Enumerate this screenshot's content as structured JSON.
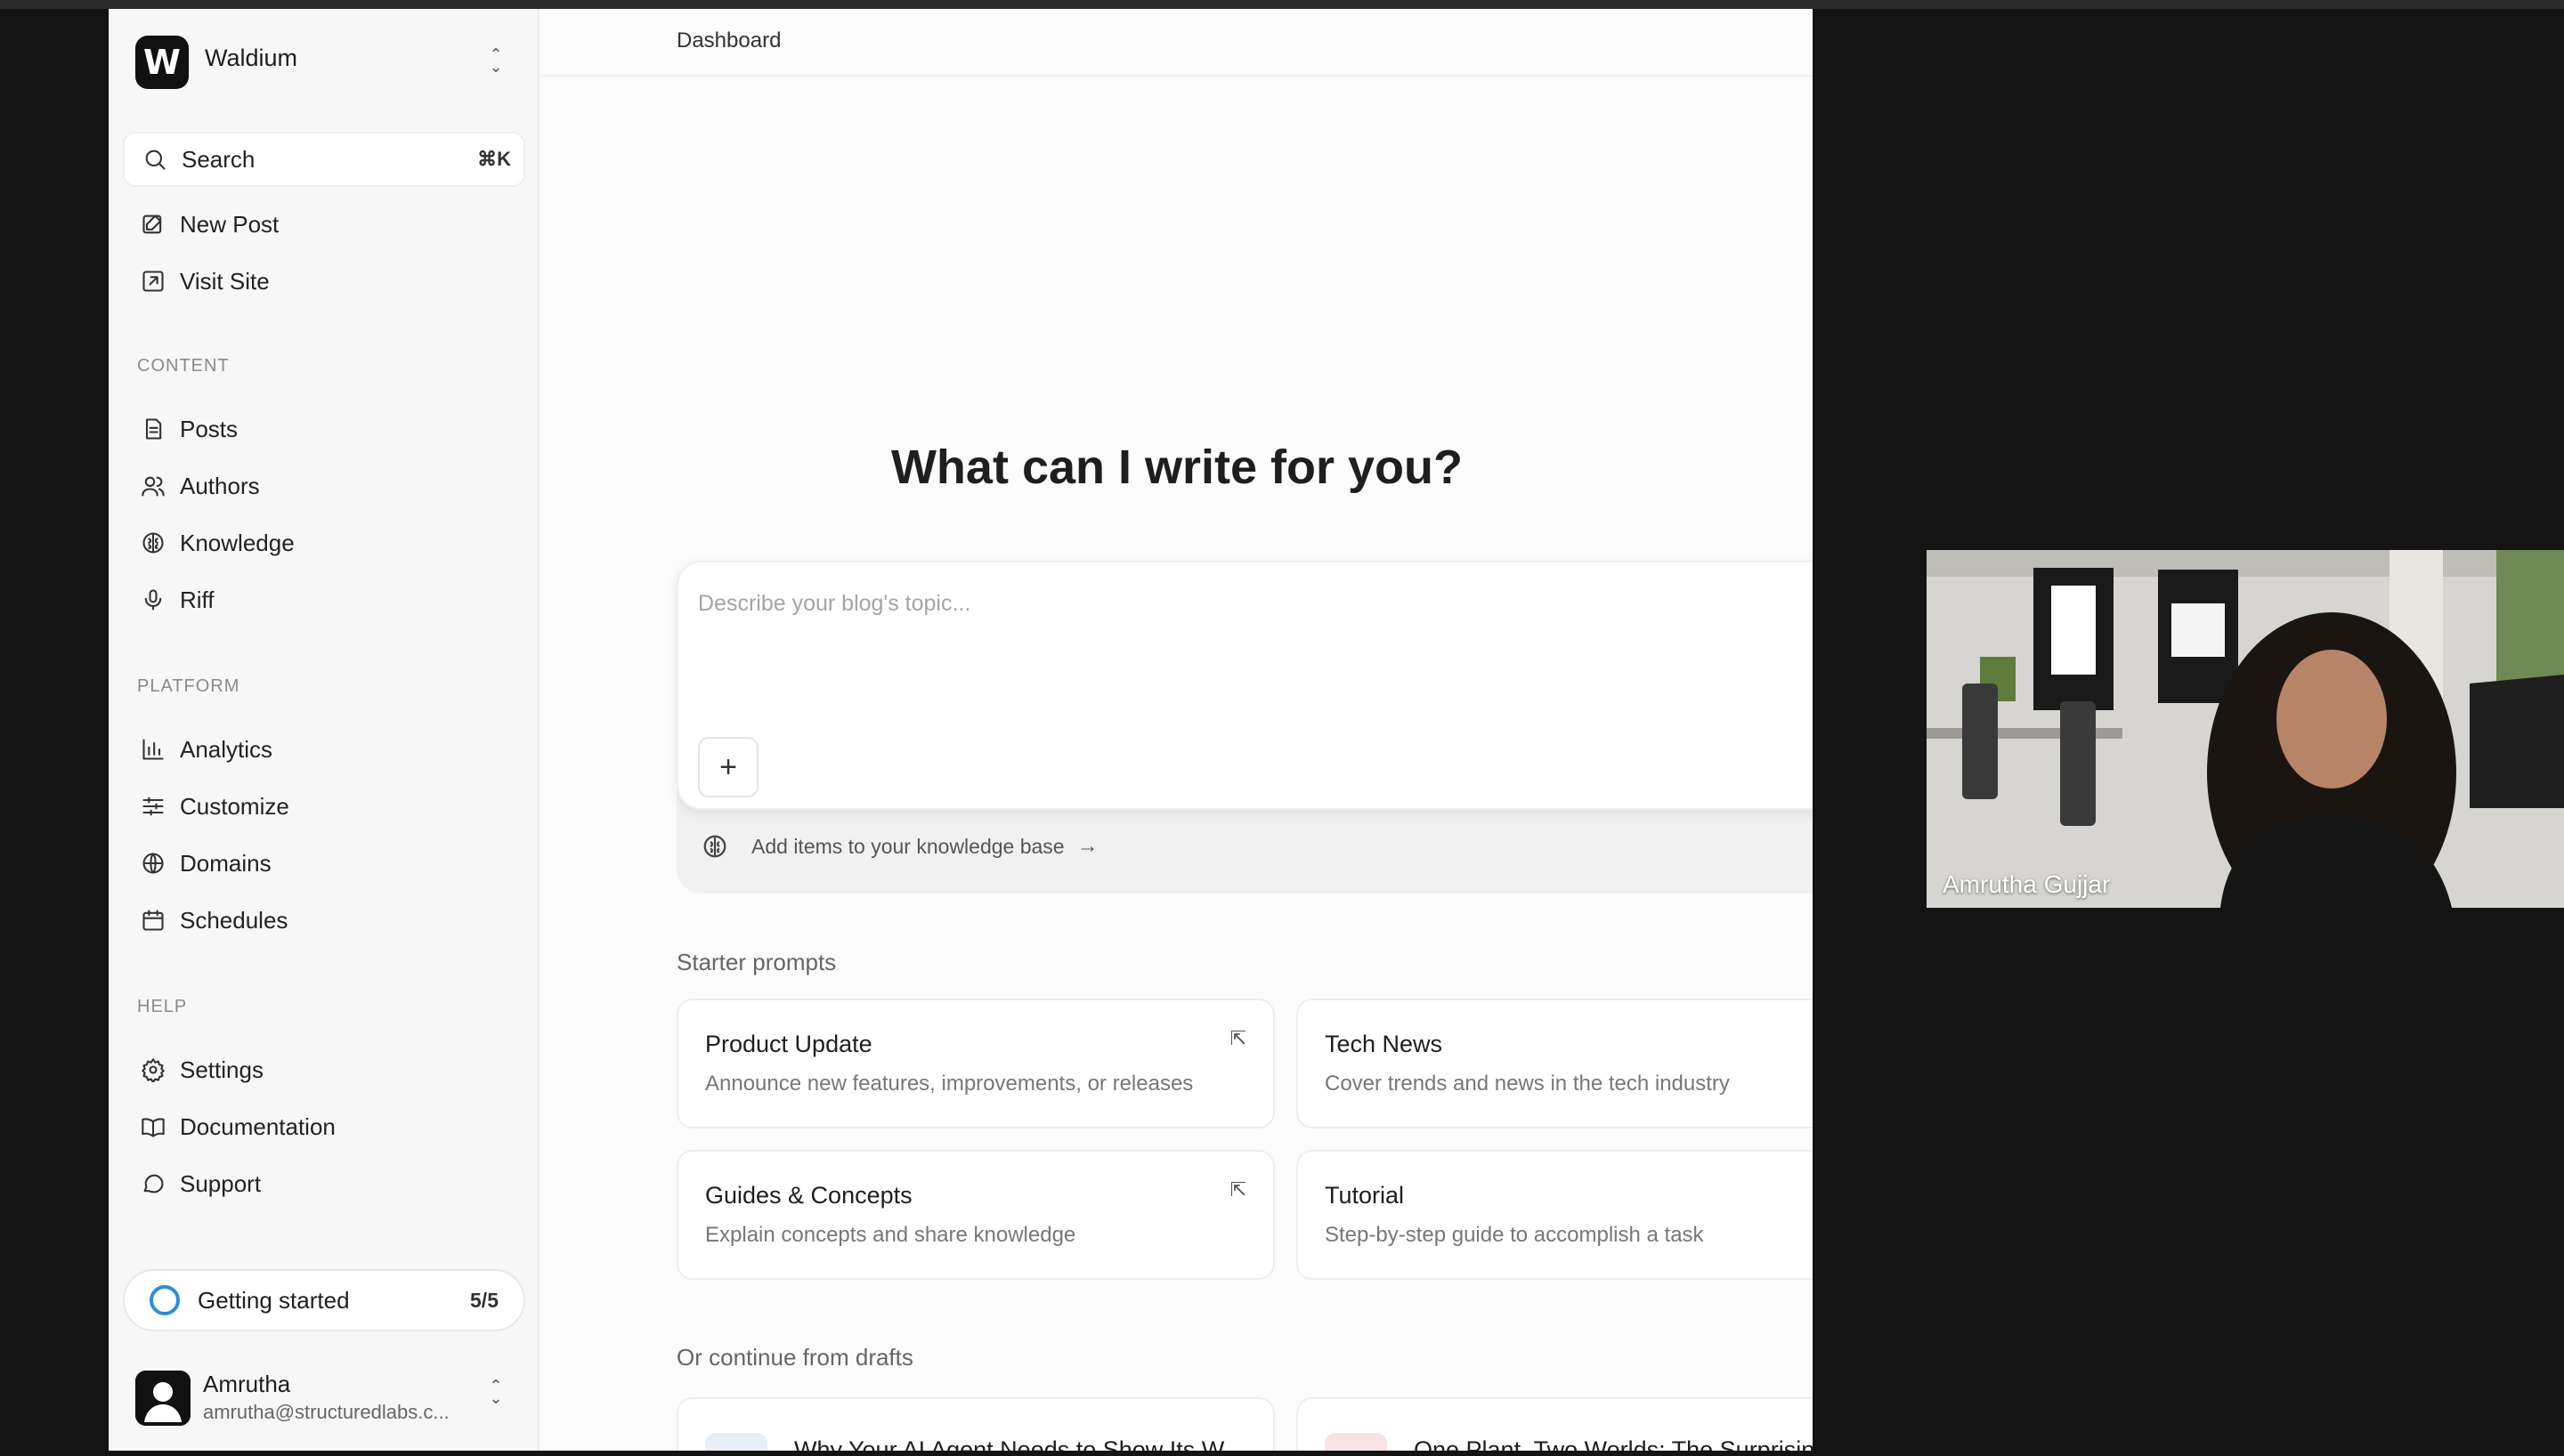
{
  "sidebar": {
    "org_name": "Waldium",
    "logo_letter": "W",
    "search": {
      "label": "Search",
      "shortcut": "⌘K"
    },
    "top_items": [
      {
        "label": "New Post",
        "icon": "edit-icon"
      },
      {
        "label": "Visit Site",
        "icon": "external-link-icon"
      }
    ],
    "sections": [
      {
        "title": "CONTENT",
        "items": [
          {
            "label": "Posts",
            "icon": "document-icon"
          },
          {
            "label": "Authors",
            "icon": "users-icon"
          },
          {
            "label": "Knowledge",
            "icon": "brain-icon"
          },
          {
            "label": "Riff",
            "icon": "microphone-icon"
          }
        ]
      },
      {
        "title": "PLATFORM",
        "items": [
          {
            "label": "Analytics",
            "icon": "bar-chart-icon"
          },
          {
            "label": "Customize",
            "icon": "sliders-icon"
          },
          {
            "label": "Domains",
            "icon": "globe-icon"
          },
          {
            "label": "Schedules",
            "icon": "calendar-icon"
          }
        ]
      },
      {
        "title": "HELP",
        "items": [
          {
            "label": "Settings",
            "icon": "gear-icon"
          },
          {
            "label": "Documentation",
            "icon": "book-icon"
          },
          {
            "label": "Support",
            "icon": "chat-bubble-icon"
          }
        ]
      }
    ],
    "getting_started": {
      "label": "Getting started",
      "count": "5/5"
    },
    "user": {
      "name": "Amrutha",
      "email": "amrutha@structuredlabs.c..."
    }
  },
  "main": {
    "breadcrumb": "Dashboard",
    "heading": "What can I write for you?",
    "composer": {
      "placeholder": "Describe your blog's topic...",
      "knowledge_link": "Add items to your knowledge base"
    },
    "starter_title": "Starter prompts",
    "starter_prompts": [
      {
        "title": "Product Update",
        "desc": "Announce new features, improvements, or releases"
      },
      {
        "title": "Tech News",
        "desc": "Cover trends and news in the tech industry"
      },
      {
        "title": "Guides & Concepts",
        "desc": "Explain concepts and share knowledge"
      },
      {
        "title": "Tutorial",
        "desc": "Step-by-step guide to accomplish a task"
      }
    ],
    "drafts_title": "Or continue from drafts",
    "drafts": [
      {
        "title": "Why Your AI Agent Needs to Show Its W..."
      },
      {
        "title": "One Plant, Two Worlds: The Surprising ..."
      }
    ]
  },
  "video": {
    "participant": "Amrutha Gujjar"
  },
  "colors": {
    "accent_ring": "#2d8cd6",
    "send_button": "#9a9a9a"
  }
}
